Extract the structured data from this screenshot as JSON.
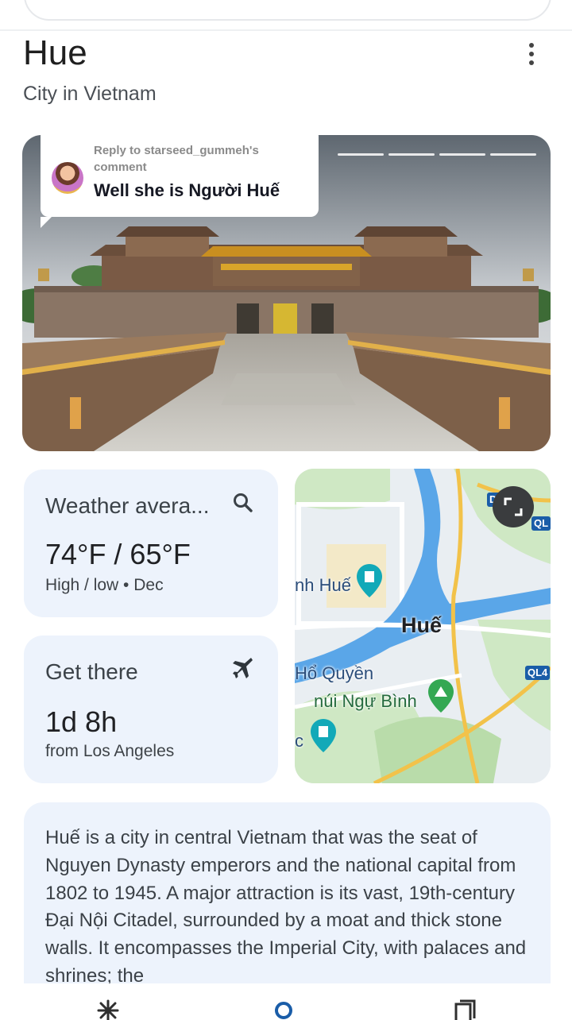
{
  "place": {
    "title": "Hue",
    "subtitle": "City in Vietnam"
  },
  "reply_overlay": {
    "meta": "Reply to starseed_gummeh's comment",
    "text": "Well she is Người Huế"
  },
  "weather_card": {
    "title": "Weather avera...",
    "temps": "74°F / 65°F",
    "detail": "High / low • Dec",
    "icon": "search-icon"
  },
  "directions_card": {
    "title": "Get there",
    "duration": "1d 8h",
    "origin": "from Los Angeles",
    "icon": "airplane-icon"
  },
  "map": {
    "city_label": "Huế",
    "labels": [
      "nh Huế",
      "Hổ Quyền",
      "núi Ngự Bình",
      "c"
    ],
    "road_badges": [
      "DT4A",
      "QL",
      "QL4"
    ]
  },
  "description": "Huế is a city in central Vietnam that was the seat of Nguyen Dynasty emperors and the national capital from 1802 to 1945. A major attraction is its vast, 19th-century Đại Nội Citadel, surrounded by a moat and thick stone walls. It encompasses the Imperial City, with palaces and shrines; the",
  "bottom_nav": [
    "sparkle-icon",
    "search-icon",
    "tabs-icon"
  ]
}
